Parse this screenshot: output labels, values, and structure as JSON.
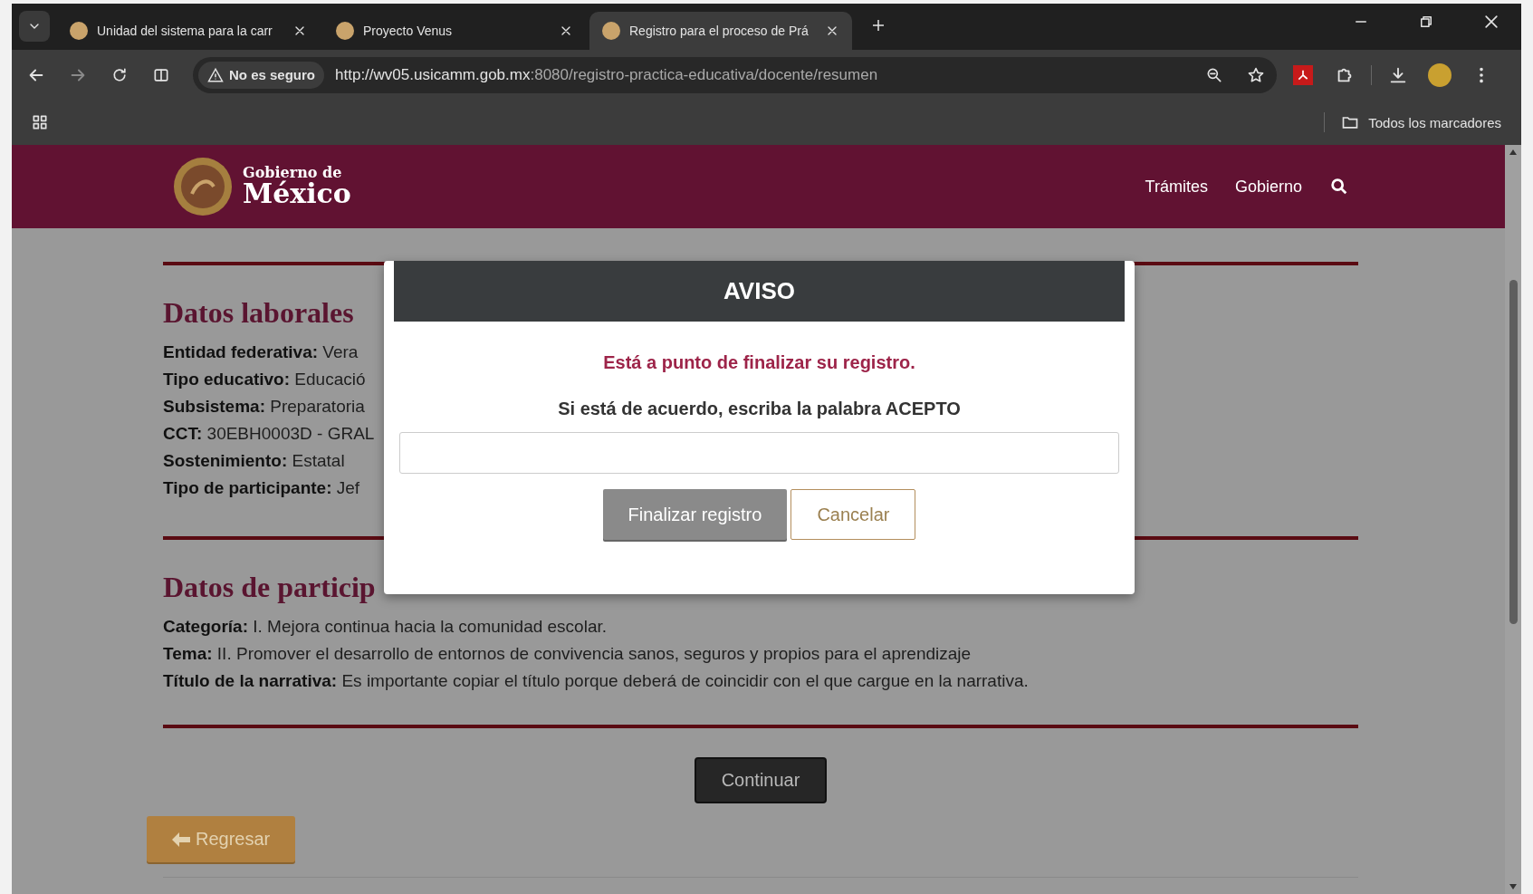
{
  "browser": {
    "tabs": [
      {
        "title": "Unidad del sistema para la carr",
        "selected": false
      },
      {
        "title": "Proyecto Venus",
        "selected": false
      },
      {
        "title": "Registro para el proceso de Prá",
        "selected": true
      }
    ],
    "security": "No es seguro",
    "url_host": "http://wv05.usicamm.gob.mx",
    "url_rest": ":8080/registro-practica-educativa/docente/resumen",
    "bookmarks": "Todos los marcadores"
  },
  "site_header": {
    "logo_line1": "Gobierno de",
    "logo_line2": "México",
    "nav": [
      "Trámites",
      "Gobierno"
    ]
  },
  "sections": [
    {
      "title": "Datos laborales",
      "fields": [
        {
          "label": "Entidad federativa:",
          "value": "Vera"
        },
        {
          "label": "Tipo educativo:",
          "value": "Educació"
        },
        {
          "label": "Subsistema:",
          "value": "Preparatoria"
        },
        {
          "label": "CCT:",
          "value": "30EBH0003D - GRAL"
        },
        {
          "label": "Sostenimiento:",
          "value": "Estatal"
        },
        {
          "label": "Tipo de participante:",
          "value": "Jef"
        }
      ]
    },
    {
      "title": "Datos de particip",
      "fields": [
        {
          "label": "Categoría:",
          "value": "I. Mejora continua hacia la comunidad escolar."
        },
        {
          "label": "Tema:",
          "value": "II. Promover el desarrollo de entornos de convivencia sanos, seguros y propios para el aprendizaje"
        },
        {
          "label": "Título de la narrativa:",
          "value": "Es importante copiar el título porque deberá de coincidir con el que cargue en la narrativa."
        }
      ]
    }
  ],
  "continue_button": "Continuar",
  "back_button": "Regresar",
  "modal": {
    "title": "AVISO",
    "message": "Está a punto de finalizar su registro.",
    "instruction": "Si está de acuerdo, escriba la palabra ACEPTO",
    "buttons": [
      {
        "label": "Finalizar registro",
        "kind": "primary"
      },
      {
        "label": "Cancelar",
        "kind": "secondary"
      }
    ]
  }
}
